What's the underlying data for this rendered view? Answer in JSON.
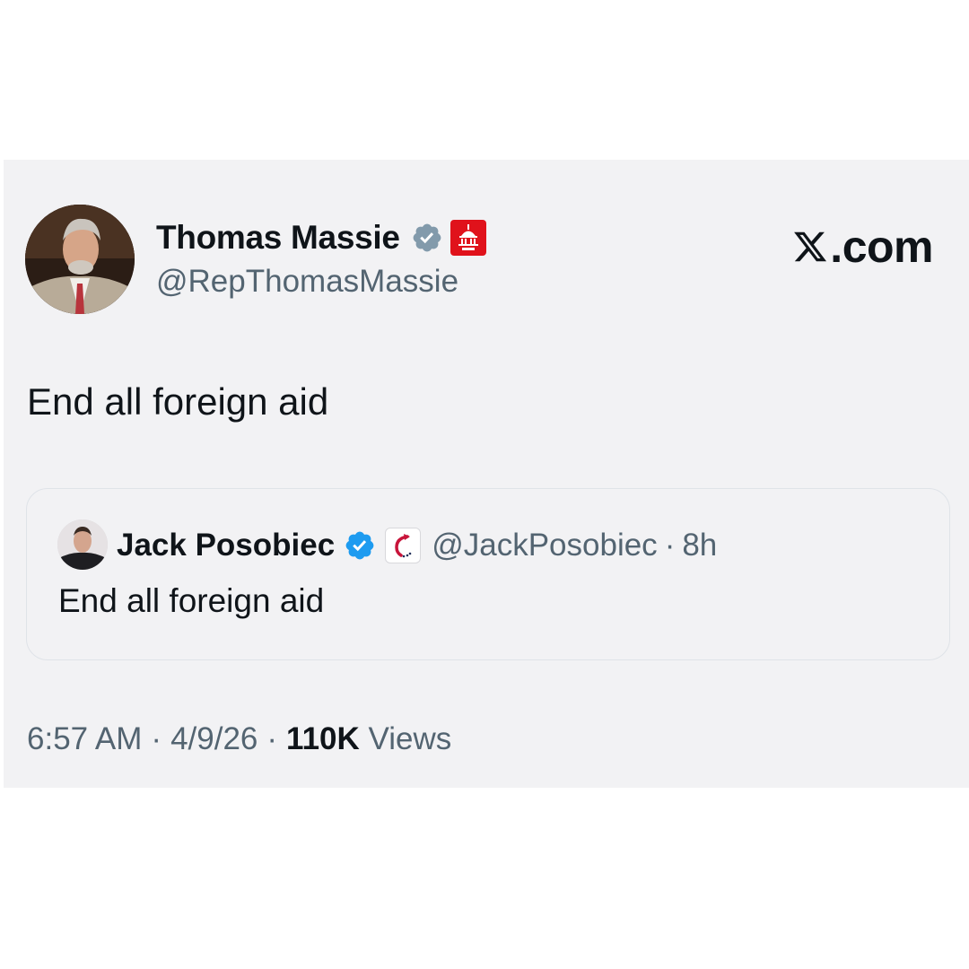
{
  "site": {
    "label": ".com",
    "logo_icon": "x-logo-icon"
  },
  "author": {
    "display_name": "Thomas Massie",
    "handle": "@RepThomasMassie",
    "verified_badge": "gray-verified-icon",
    "affiliation_badge": "capitol-badge-icon"
  },
  "tweet": {
    "text": "End all foreign aid"
  },
  "quoted": {
    "display_name": "Jack Posobiec",
    "handle": "@JackPosobiec",
    "separator": "·",
    "time": "8h",
    "text": "End all foreign aid",
    "verified_badge": "blue-verified-icon",
    "affiliation_badge": "org-badge-icon"
  },
  "meta": {
    "time": "6:57 AM",
    "separator": "·",
    "date": "4/9/26",
    "views_count": "110K",
    "views_label": "Views"
  },
  "colors": {
    "text": "#0f1419",
    "secondary": "#536471",
    "card_bg": "#f2f2f4",
    "verified_blue": "#1d9bf0",
    "verified_gray": "#829aab",
    "gov_red": "#e0121b"
  }
}
